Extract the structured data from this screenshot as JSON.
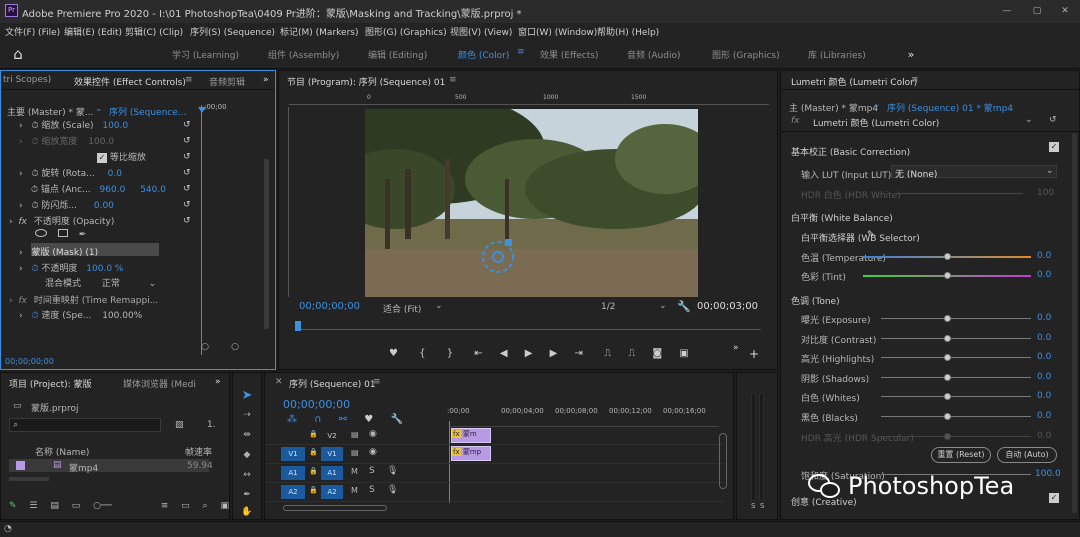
{
  "title": {
    "text": "Adobe Premiere Pro 2020 - I:\\01 PhotoshopTea\\0409 Pr进阶：蒙版\\Masking and Tracking\\蒙版.prproj *",
    "app_icon": "Pr"
  },
  "menu": [
    "文件(F) (File)",
    "编辑(E) (Edit)",
    "剪辑(C) (Clip)",
    "序列(S) (Sequence)",
    "标记(M) (Markers)",
    "图形(G) (Graphics)",
    "视图(V) (View)",
    "窗口(W) (Window)",
    "帮助(H) (Help)"
  ],
  "workspaces": [
    "学习 (Learning)",
    "组件 (Assembly)",
    "编辑 (Editing)",
    "颜色 (Color)",
    "效果 (Effects)",
    "音频 (Audio)",
    "图形 (Graphics)",
    "库 (Libraries)"
  ],
  "effect_controls": {
    "tabs": [
      "tri Scopes)",
      "效果控件 (Effect Controls)",
      "音频剪辑"
    ],
    "master": "主要 (Master) * 蒙...",
    "sequence": "序列 (Sequence...",
    "ruler_time": ";00;00",
    "rows": [
      {
        "label": "缩放 (Scale)",
        "value": "100.0"
      },
      {
        "label": "缩放宽度",
        "value": "100.0"
      },
      {
        "label": "等比缩放",
        "value": ""
      },
      {
        "label": "旋转 (Rota...",
        "value": "0.0"
      },
      {
        "label": "锚点 (Anc...",
        "value": "960.0",
        "value2": "540.0"
      },
      {
        "label": "防闪烁...",
        "value": "0.00"
      },
      {
        "label": "不透明度 (Opacity)",
        "value": ""
      },
      {
        "label": "蒙版 (Mask) (1)",
        "value": ""
      },
      {
        "label": "不透明度",
        "value": "100.0 %"
      },
      {
        "label": "混合模式",
        "value": "正常"
      },
      {
        "label": "时间重映射 (Time Remappi...",
        "value": ""
      },
      {
        "label": "速度 (Spe...",
        "value": "100.00%"
      }
    ],
    "timecode": "00;00;00;00"
  },
  "program": {
    "tab": "节目 (Program): 序列 (Sequence) 01",
    "ruler_marks": [
      "0",
      "500",
      "1000",
      "1500"
    ],
    "timecode": "00;00;00;00",
    "fit": "适合 (Fit)",
    "resolution": "1/2",
    "duration": "00;00;03;00"
  },
  "lumetri": {
    "tab": "Lumetri 颜色 (Lumetri Color)",
    "master": "主 (Master) * 蒙mp4",
    "sequence": "序列 (Sequence) 01 * 蒙mp4",
    "effect": "Lumetri 颜色 (Lumetri Color)",
    "basic": "基本校正 (Basic Correction)",
    "input_lut_label": "输入 LUT (Input LUT)",
    "input_lut_value": "无 (None)",
    "hdr_white_label": "HDR 白色 (HDR White)",
    "hdr_white_value": "100",
    "white_balance": "白平衡 (White Balance)",
    "wb_selector": "白平衡选择器 (WB Selector)",
    "temperature": {
      "label": "色温 (Temperature)",
      "value": "0.0"
    },
    "tint": {
      "label": "色彩 (Tint)",
      "value": "0.0"
    },
    "tone": "色调 (Tone)",
    "tone_rows": [
      {
        "label": "曝光 (Exposure)",
        "value": "0.0"
      },
      {
        "label": "对比度 (Contrast)",
        "value": "0.0"
      },
      {
        "label": "高光 (Highlights)",
        "value": "0.0"
      },
      {
        "label": "阴影 (Shadows)",
        "value": "0.0"
      },
      {
        "label": "白色 (Whites)",
        "value": "0.0"
      },
      {
        "label": "黑色 (Blacks)",
        "value": "0.0"
      },
      {
        "label": "HDR 高光 (HDR Specular)",
        "value": "0.0"
      }
    ],
    "reset": "重置 (Reset)",
    "auto": "自动 (Auto)",
    "saturation": {
      "label": "饱和度 (Saturation)",
      "value": "100.0"
    },
    "creative": "创意 (Creative)"
  },
  "project": {
    "tabs": [
      "项目 (Project): 蒙版",
      "媒体浏览器 (Medi"
    ],
    "file": "蒙版.prproj",
    "col_name": "名称 (Name)",
    "col_rate": "帧速率",
    "item_name": "蒙mp4",
    "item_rate": "59.94"
  },
  "timeline": {
    "tab": "序列 (Sequence) 01",
    "timecode": "00;00;00;00",
    "ruler": [
      ":00;00",
      "00;00;04;00",
      "00;00;08;00",
      "00;00;12;00",
      "00;00;16;00"
    ],
    "tracks": [
      {
        "name": "V2"
      },
      {
        "name": "V1",
        "source": "V1"
      },
      {
        "name": "A1",
        "source": "A1"
      },
      {
        "name": "A2",
        "source": "A2"
      }
    ],
    "clip_v2": "蒙m",
    "clip_v1": "蒙mp"
  },
  "audio_meter_labels": [
    "S",
    "S"
  ],
  "watermark": "PhotoshopTea",
  "colors": {
    "accent": "#3d8fe0",
    "clip": "#b89ae4",
    "panel": "#232323"
  }
}
